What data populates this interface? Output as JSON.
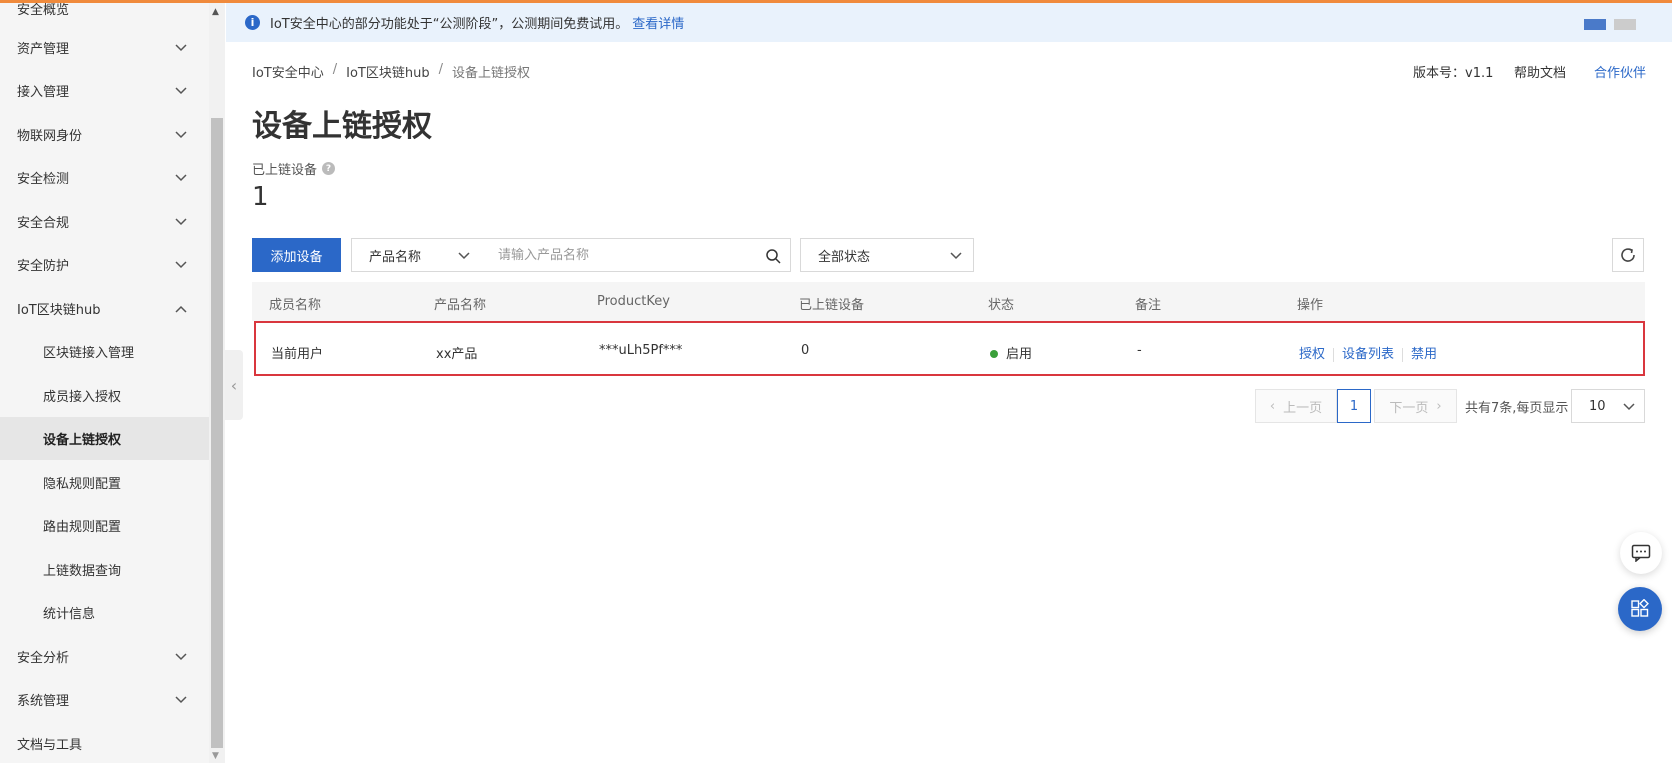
{
  "banner": {
    "text": "IoT安全中心的部分功能处于“公测阶段”，公测期间免费试用。",
    "link": "查看详情"
  },
  "sidebar": {
    "items": [
      {
        "label": "安全概览"
      },
      {
        "label": "资产管理"
      },
      {
        "label": "接入管理"
      },
      {
        "label": "物联网身份"
      },
      {
        "label": "安全检测"
      },
      {
        "label": "安全合规"
      },
      {
        "label": "安全防护"
      },
      {
        "label": "IoT区块链hub"
      },
      {
        "label": "区块链接入管理"
      },
      {
        "label": "成员接入授权"
      },
      {
        "label": "设备上链授权"
      },
      {
        "label": "隐私规则配置"
      },
      {
        "label": "路由规则配置"
      },
      {
        "label": "上链数据查询"
      },
      {
        "label": "统计信息"
      },
      {
        "label": "安全分析"
      },
      {
        "label": "系统管理"
      },
      {
        "label": "文档与工具"
      }
    ]
  },
  "breadcrumb": {
    "items": [
      "IoT安全中心",
      "IoT区块链hub",
      "设备上链授权"
    ],
    "sep": "/"
  },
  "header": {
    "version": "版本号：v1.1",
    "help": "帮助文档",
    "partner": "合作伙伴"
  },
  "page": {
    "title": "设备上链授权",
    "stat_label": "已上链设备",
    "stat_value": "1"
  },
  "toolbar": {
    "add_button": "添加设备",
    "product_select": "产品名称",
    "search_placeholder": "请输入产品名称",
    "status_select": "全部状态"
  },
  "table": {
    "headers": [
      "成员名称",
      "产品名称",
      "ProductKey",
      "已上链设备",
      "状态",
      "备注",
      "操作"
    ],
    "rows": [
      {
        "member": "当前用户",
        "product": "xx产品",
        "product_key": "***uLh5Pf***",
        "devices": "0",
        "status": "启用",
        "remark": "-",
        "actions": [
          "授权",
          "设备列表",
          "禁用"
        ]
      }
    ]
  },
  "pagination": {
    "prev": "上一页",
    "current": "1",
    "next": "下一页",
    "total_text": "共有7条,每页显示",
    "page_size": "10"
  },
  "colors": {
    "primary": "#2b68c8",
    "highlight_border": "#d9363e",
    "status_enabled": "#3a9f3a"
  },
  "icons": [
    "info-icon",
    "chevron-down-icon",
    "chevron-up-icon",
    "question-icon",
    "search-icon",
    "refresh-icon",
    "chat-icon",
    "apps-icon"
  ]
}
